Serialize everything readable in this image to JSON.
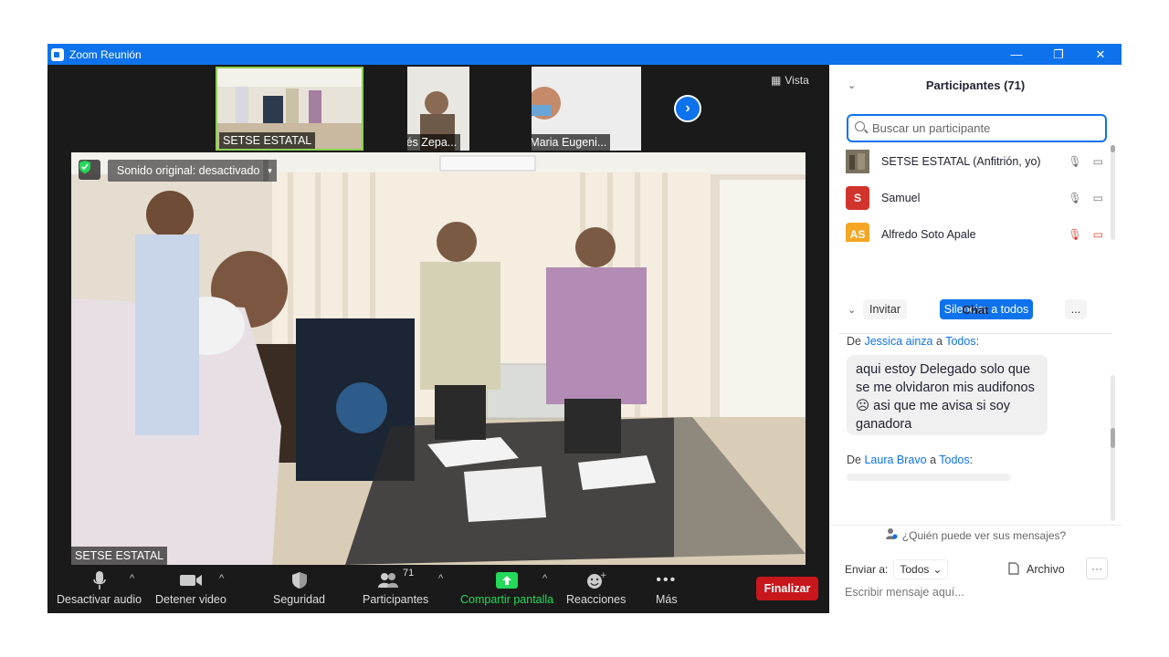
{
  "window": {
    "title": "Zoom Reunión",
    "controls": [
      "—",
      "❐",
      "✕"
    ]
  },
  "thumbnails": [
    {
      "label": "SETSE ESTATAL",
      "muted": false
    },
    {
      "label": "Andrés Zepa...",
      "muted": true
    },
    {
      "label": "Maria Eugeni...",
      "muted": true
    }
  ],
  "view_button": "Vista",
  "main_video": {
    "sound_label": "Sonido original: desactivado",
    "speaker_label": "SETSE ESTATAL"
  },
  "toolbar": {
    "mute": "Desactivar audio",
    "video": "Detener video",
    "security": "Seguridad",
    "participants": "Participantes",
    "participants_count": "71",
    "share": "Compartir pantalla",
    "reactions": "Reacciones",
    "more": "Más",
    "end": "Finalizar",
    "share_color": "#23d959",
    "end_color": "#c8161d"
  },
  "participants_panel": {
    "title": "Participantes (71)",
    "search_placeholder": "Buscar un participante",
    "list": [
      {
        "name": "SETSE ESTATAL (Anfitrión, yo)",
        "avatar": "",
        "color": "#6b6454",
        "muted": false
      },
      {
        "name": "Samuel",
        "avatar": "S",
        "color": "#d0342c",
        "muted": false
      },
      {
        "name": "Alfredo Soto Apale",
        "avatar": "AS",
        "color": "#f5a623",
        "muted": true
      }
    ],
    "invite": "Invitar",
    "mute_all": "Silenciar a todos",
    "more": "..."
  },
  "chat": {
    "title": "Chat",
    "messages": [
      {
        "from_prefix": "De",
        "from": "Jessica ainza",
        "to_prefix": "a",
        "to": "Todos",
        "text": "aqui estoy Delegado solo que se me olvidaron mis audifonos ☹ asi que me avisa si soy ganadora"
      },
      {
        "from_prefix": "De",
        "from": "Laura Bravo",
        "to_prefix": "a",
        "to": "Todos",
        "text": ""
      }
    ],
    "who_sees": "¿Quién puede ver sus mensajes?",
    "send_to_label": "Enviar a:",
    "send_to_value": "Todos",
    "file_label": "Archivo",
    "input_placeholder": "Escribir mensaje aquí..."
  }
}
